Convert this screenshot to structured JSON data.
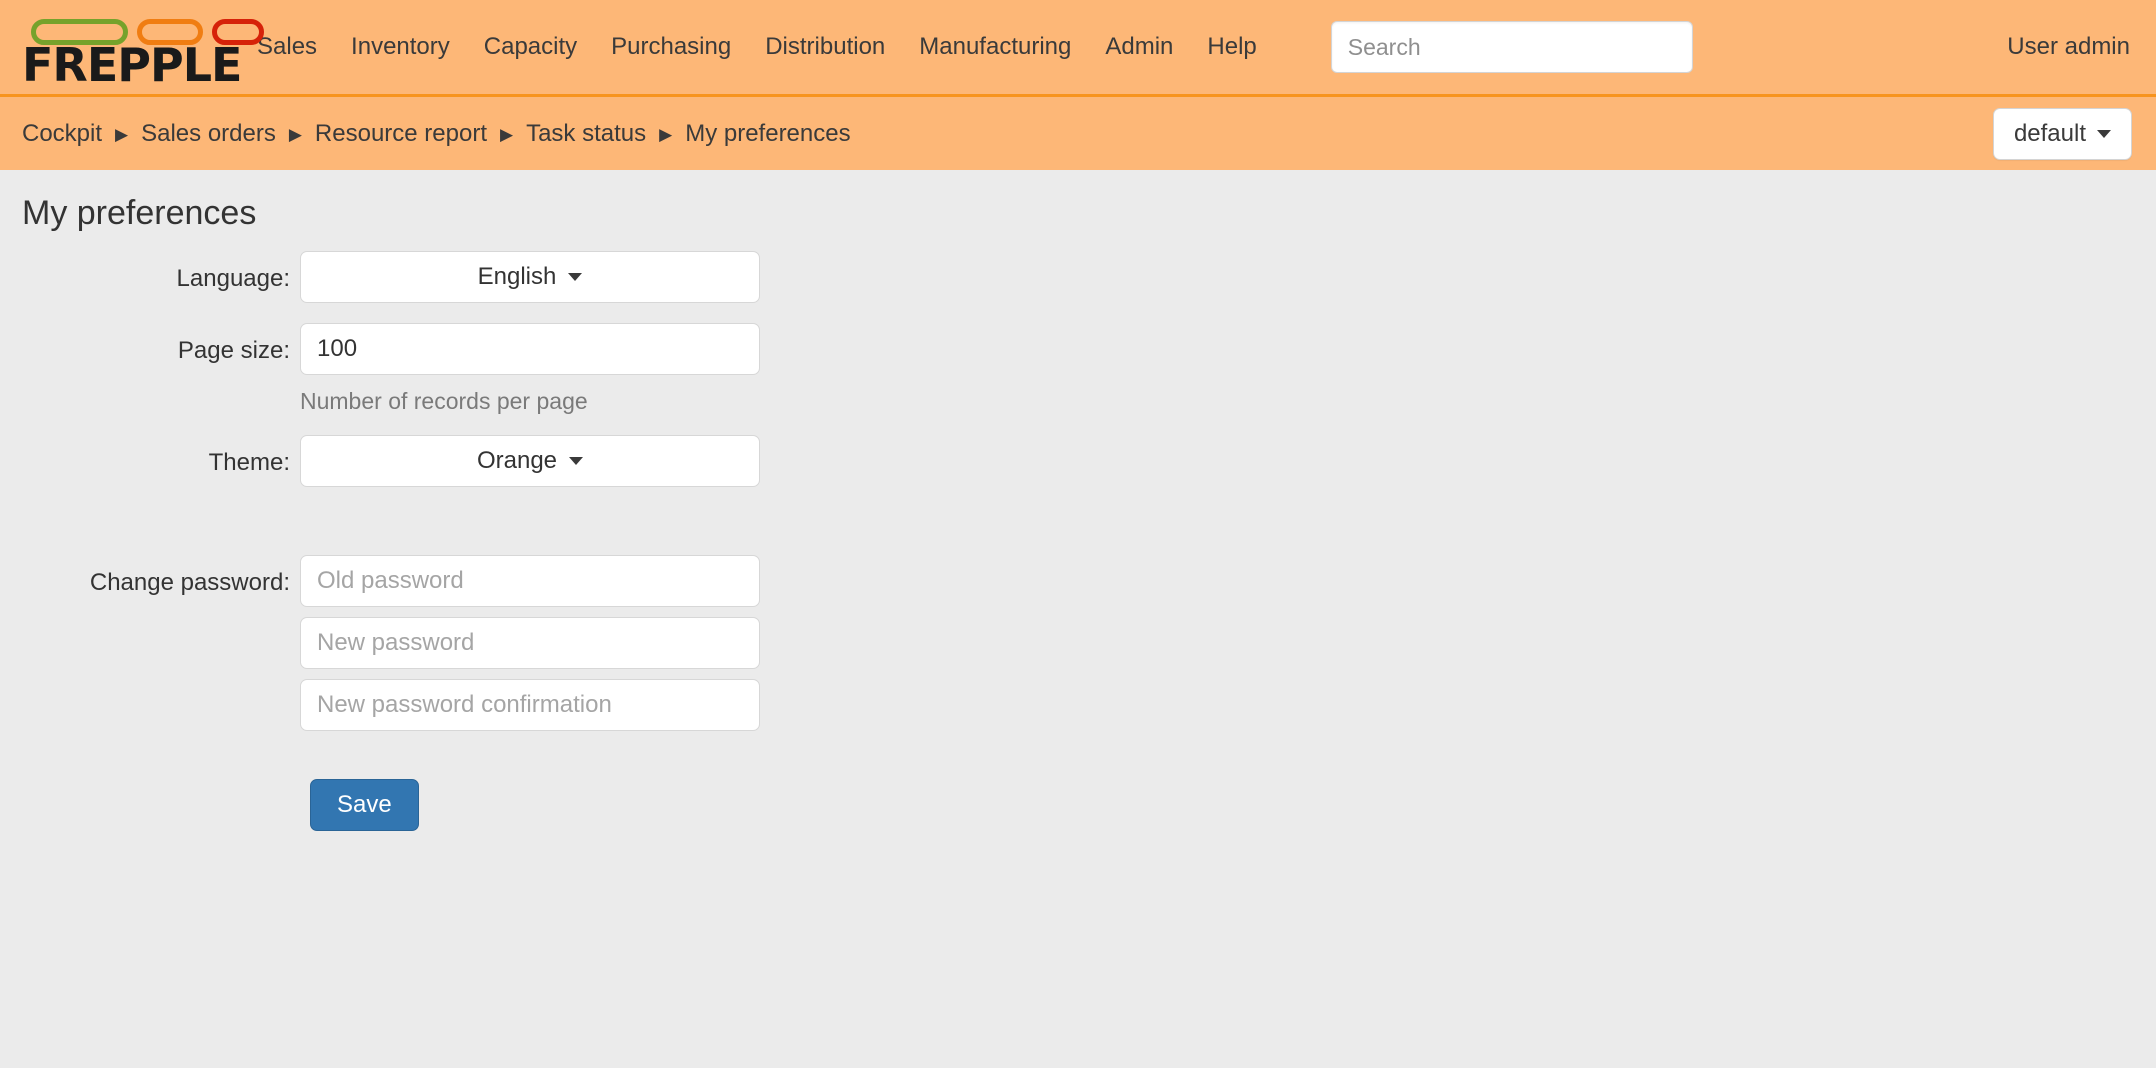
{
  "header": {
    "logo_text": "FREPPLE",
    "logo_pill_colors": [
      "#76a22b",
      "#f07d12",
      "#d62209"
    ],
    "nav": [
      {
        "label": "Sales"
      },
      {
        "label": "Inventory"
      },
      {
        "label": "Capacity"
      },
      {
        "label": "Purchasing"
      },
      {
        "label": "Distribution"
      },
      {
        "label": "Manufacturing"
      },
      {
        "label": "Admin"
      },
      {
        "label": "Help"
      }
    ],
    "search": {
      "value": "",
      "placeholder": "Search"
    },
    "user": "User admin",
    "background_color": "#fdb777",
    "divider_color": "#f7941e"
  },
  "breadcrumb": {
    "items": [
      {
        "label": "Cockpit"
      },
      {
        "label": "Sales orders"
      },
      {
        "label": "Resource report"
      },
      {
        "label": "Task status"
      },
      {
        "label": "My preferences"
      }
    ],
    "separator": "▶",
    "scenario_button": {
      "label": "default"
    }
  },
  "main": {
    "page_title": "My preferences",
    "form": {
      "language": {
        "label": "Language:",
        "value": "English"
      },
      "page_size": {
        "label": "Page size:",
        "value": "100",
        "help": "Number of records per page"
      },
      "theme": {
        "label": "Theme:",
        "value": "Orange"
      },
      "change_password": {
        "label": "Change password:",
        "old_placeholder": "Old password",
        "new_placeholder": "New password",
        "confirm_placeholder": "New password confirmation"
      },
      "save_label": "Save"
    }
  }
}
